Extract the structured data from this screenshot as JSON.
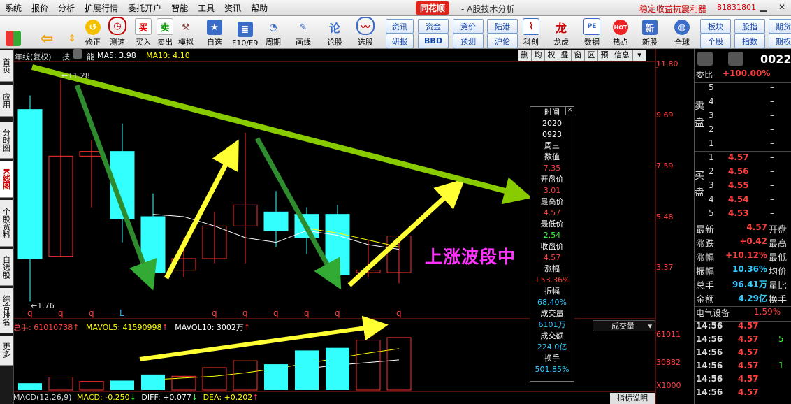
{
  "menubar": {
    "items": [
      "系统",
      "报价",
      "分析",
      "扩展行情",
      "委托开户",
      "智能",
      "工具",
      "资讯",
      "帮助"
    ],
    "brand": "同花顺",
    "brand_sub": "- A股技术分析",
    "right_text": "稳定收益抗震利器",
    "right_number": "81831801"
  },
  "toolbar": {
    "buttons": [
      "修正",
      "测速",
      "买入",
      "卖出",
      "模拟",
      "自选",
      "F10/F9",
      "周期",
      "画线",
      "论股",
      "选股",
      "科创",
      "龙虎",
      "数据",
      "热点",
      "新股",
      "全球"
    ],
    "small_buttons": [
      "资讯",
      "资金",
      "竞价",
      "陆港",
      "研报",
      "BBD",
      "预测",
      "沪伦",
      "板块",
      "股指",
      "期货",
      "个股",
      "指数",
      "期权"
    ]
  },
  "sidebar": {
    "tabs": [
      "首页",
      "应用",
      "分时图",
      "K线图",
      "个股资料",
      "自选股",
      "综合排名",
      "更多"
    ]
  },
  "chart_header": {
    "period": "年线(复权)",
    "name_fragment": "技",
    "name_tail": "能",
    "ma5_label": "MA5: 3.98",
    "ma10_label": "MA10: 4.10",
    "tools": [
      "删",
      "均",
      "权",
      "叠",
      "窗",
      "区",
      "预",
      "信息"
    ]
  },
  "price_axis": [
    "11.80",
    "9.69",
    "7.59",
    "5.48",
    "3.37"
  ],
  "volume_axis": [
    "61011",
    "30882",
    "X1000"
  ],
  "annotations": {
    "high": "11.28",
    "low": "1.76",
    "wave_text": "上涨波段中",
    "markers": [
      "q",
      "q",
      "q",
      "L",
      "q",
      "q",
      "q",
      "q",
      "q",
      "q"
    ]
  },
  "info_box": {
    "lines": [
      {
        "t": "时间",
        "c": "#ffffff"
      },
      {
        "t": "2020",
        "c": "#ffffff"
      },
      {
        "t": "0923",
        "c": "#ffffff"
      },
      {
        "t": "周三",
        "c": "#ffffff"
      },
      {
        "t": "数值",
        "c": "#ffffff"
      },
      {
        "t": "7.35",
        "c": "#ff4040"
      },
      {
        "t": "开盘价",
        "c": "#ffffff"
      },
      {
        "t": "3.01",
        "c": "#ff4040"
      },
      {
        "t": "最高价",
        "c": "#ffffff"
      },
      {
        "t": "4.57",
        "c": "#ff4040"
      },
      {
        "t": "最低价",
        "c": "#ffffff"
      },
      {
        "t": "2.54",
        "c": "#33ff33"
      },
      {
        "t": "收盘价",
        "c": "#ffffff"
      },
      {
        "t": "4.57",
        "c": "#ff4040"
      },
      {
        "t": "涨幅",
        "c": "#ffffff"
      },
      {
        "t": "+53.36%",
        "c": "#ff4040"
      },
      {
        "t": "振幅",
        "c": "#ffffff"
      },
      {
        "t": "68.40%",
        "c": "#33ccff"
      },
      {
        "t": "成交量",
        "c": "#ffffff"
      },
      {
        "t": "6101万",
        "c": "#33ccff"
      },
      {
        "t": "成交额",
        "c": "#ffffff"
      },
      {
        "t": "224.0亿",
        "c": "#33ccff"
      },
      {
        "t": "换手",
        "c": "#ffffff"
      },
      {
        "t": "501.85%",
        "c": "#33ccff"
      }
    ]
  },
  "volume_header": {
    "total": "总手: 61010738",
    "mavol5": "MAVOL5: 41590998",
    "mavol10": "MAVOL10: 3002万",
    "dropdown": "成交量"
  },
  "macd_header": {
    "label": "MACD(12,26,9)",
    "macd": "MACD: -0.250",
    "diff": "DIFF: +0.077",
    "dea": "DEA: +0.202",
    "button": "指标说明"
  },
  "right_panel": {
    "code": "0022",
    "webi_label": "委比",
    "webi_value": "+100.00%",
    "sell_label": "卖盘",
    "buy_label": "买盘",
    "sell": [
      {
        "n": "5",
        "p": "",
        "v": "–"
      },
      {
        "n": "4",
        "p": "",
        "v": "–"
      },
      {
        "n": "3",
        "p": "",
        "v": "–"
      },
      {
        "n": "2",
        "p": "",
        "v": "–"
      },
      {
        "n": "1",
        "p": "",
        "v": "–"
      }
    ],
    "buy": [
      {
        "n": "1",
        "p": "4.57",
        "v": "–"
      },
      {
        "n": "2",
        "p": "4.56",
        "v": "–"
      },
      {
        "n": "3",
        "p": "4.55",
        "v": "–"
      },
      {
        "n": "4",
        "p": "4.54",
        "v": "–"
      },
      {
        "n": "5",
        "p": "4.53",
        "v": "–"
      }
    ],
    "stats": [
      {
        "k": "最新",
        "v": "4.57",
        "k2": "开盘",
        "c": "#ff4040"
      },
      {
        "k": "涨跌",
        "v": "+0.42",
        "k2": "最高",
        "c": "#ff4040"
      },
      {
        "k": "涨幅",
        "v": "+10.12%",
        "k2": "最低",
        "c": "#ff4040"
      },
      {
        "k": "振幅",
        "v": "10.36%",
        "k2": "均价",
        "c": "#33ccff"
      },
      {
        "k": "总手",
        "v": "96.41万",
        "k2": "量比",
        "c": "#33ccff"
      },
      {
        "k": "金额",
        "v": "4.29亿",
        "k2": "换手",
        "c": "#33ccff"
      }
    ],
    "sector": "电气设备",
    "sector_pct": "1.59%",
    "ticks": [
      {
        "t": "14:56",
        "p": "4.57",
        "v": ""
      },
      {
        "t": "14:56",
        "p": "4.57",
        "v": "5"
      },
      {
        "t": "14:56",
        "p": "4.57",
        "v": ""
      },
      {
        "t": "14:56",
        "p": "4.57",
        "v": "1"
      },
      {
        "t": "14:56",
        "p": "4.57",
        "v": ""
      },
      {
        "t": "14:56",
        "p": "4.57",
        "v": ""
      }
    ]
  },
  "chart_data": {
    "type": "candlestick",
    "candles": [
      {
        "o": 3.6,
        "c": 10.0,
        "h": 10.6,
        "l": 1.76,
        "dir": "down"
      },
      {
        "o": 3.7,
        "c": 8.0,
        "h": 11.28,
        "l": 3.7,
        "dir": "up"
      },
      {
        "o": 8.0,
        "c": 8.2,
        "h": 8.7,
        "l": 5.8,
        "dir": "up"
      },
      {
        "o": 8.2,
        "c": 5.3,
        "h": 9.4,
        "l": 4.3,
        "dir": "down"
      },
      {
        "o": 5.4,
        "c": 3.0,
        "h": 6.4,
        "l": 2.6,
        "dir": "down"
      },
      {
        "o": 3.1,
        "c": 3.6,
        "h": 4.5,
        "l": 2.8,
        "dir": "up"
      },
      {
        "o": 3.6,
        "c": 5.0,
        "h": 5.6,
        "l": 3.4,
        "dir": "up"
      },
      {
        "o": 5.0,
        "c": 5.9,
        "h": 9.0,
        "l": 3.4,
        "dir": "up"
      },
      {
        "o": 5.6,
        "c": 4.8,
        "h": 6.5,
        "l": 4.1,
        "dir": "down"
      },
      {
        "o": 5.5,
        "c": 4.5,
        "h": 5.8,
        "l": 3.8,
        "dir": "down"
      },
      {
        "o": 5.5,
        "c": 2.9,
        "h": 5.9,
        "l": 2.7,
        "dir": "down"
      },
      {
        "o": 3.0,
        "c": 3.1,
        "h": 4.4,
        "l": 2.8,
        "dir": "up"
      },
      {
        "o": 3.0,
        "c": 4.57,
        "h": 4.57,
        "l": 2.54,
        "dir": "up"
      }
    ],
    "volume": [
      {
        "v": 8,
        "dir": "down"
      },
      {
        "v": 15,
        "dir": "up"
      },
      {
        "v": 10,
        "dir": "up"
      },
      {
        "v": 11,
        "dir": "down"
      },
      {
        "v": 18,
        "dir": "down"
      },
      {
        "v": 16,
        "dir": "up"
      },
      {
        "v": 26,
        "dir": "up"
      },
      {
        "v": 34,
        "dir": "up"
      },
      {
        "v": 30,
        "dir": "down"
      },
      {
        "v": 46,
        "dir": "down"
      },
      {
        "v": 49,
        "dir": "down"
      },
      {
        "v": 58,
        "dir": "up"
      },
      {
        "v": 61,
        "dir": "up"
      }
    ],
    "ma5": [
      null,
      null,
      null,
      null,
      5.5,
      5.4,
      5.0,
      4.5,
      4.3,
      4.8,
      4.6,
      4.2,
      4.0
    ],
    "ma10": [
      null,
      null,
      null,
      null,
      null,
      null,
      null,
      null,
      null,
      4.9,
      4.7,
      4.4,
      4.1
    ],
    "mavol5": [
      null,
      null,
      null,
      null,
      12,
      14,
      16,
      20,
      25,
      31,
      37,
      43,
      48
    ],
    "mavol10": [
      null,
      null,
      null,
      null,
      null,
      null,
      null,
      null,
      null,
      25,
      29,
      32,
      35
    ],
    "price_range": [
      1.5,
      12.0
    ],
    "volume_max": 65,
    "colors": {
      "up": "#ff3030",
      "down": "#33ffff",
      "ma5": "#ffffff",
      "ma10": "#ffff00",
      "green_arrow": "#33aa33",
      "yellow_arrow": "#ffff33",
      "trend_arrow": "#88cc00"
    }
  }
}
